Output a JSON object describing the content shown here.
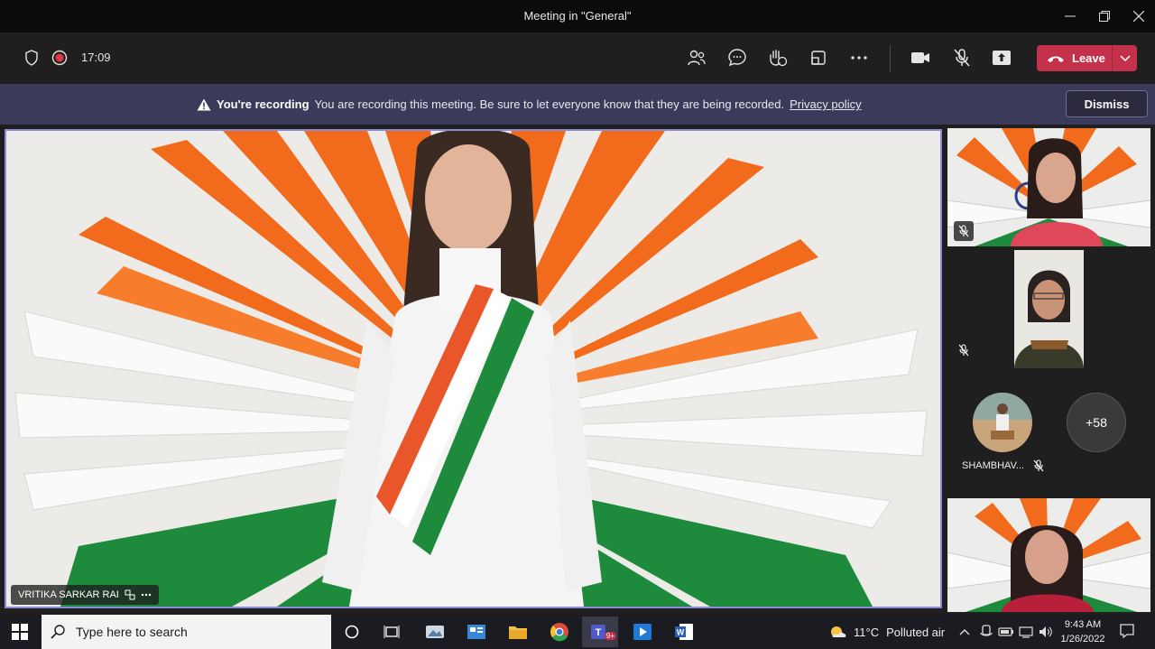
{
  "window": {
    "title": "Meeting in \"General\""
  },
  "toolbar": {
    "timer": "17:09",
    "leave_label": "Leave"
  },
  "banner": {
    "heading": "You're recording",
    "message": "You are recording this meeting. Be sure to let everyone know that they are being recorded.",
    "link": "Privacy policy",
    "dismiss_label": "Dismiss"
  },
  "main_video": {
    "participant_name": "VRITIKA SARKAR RAI"
  },
  "participants": {
    "shambhav_label": "SHAMBHAV...",
    "overflow_count": "+58"
  },
  "taskbar": {
    "search_placeholder": "Type here to search",
    "teams_badge": "9+",
    "weather_temp": "11°C",
    "weather_desc": "Polluted air",
    "time": "9:43 AM",
    "date": "1/26/2022"
  },
  "colors": {
    "leave": "#c4314b",
    "banner": "#3b3a5a",
    "active_border": "#8e8cd8",
    "saffron": "#f26a1b",
    "green": "#1e8a3c"
  }
}
